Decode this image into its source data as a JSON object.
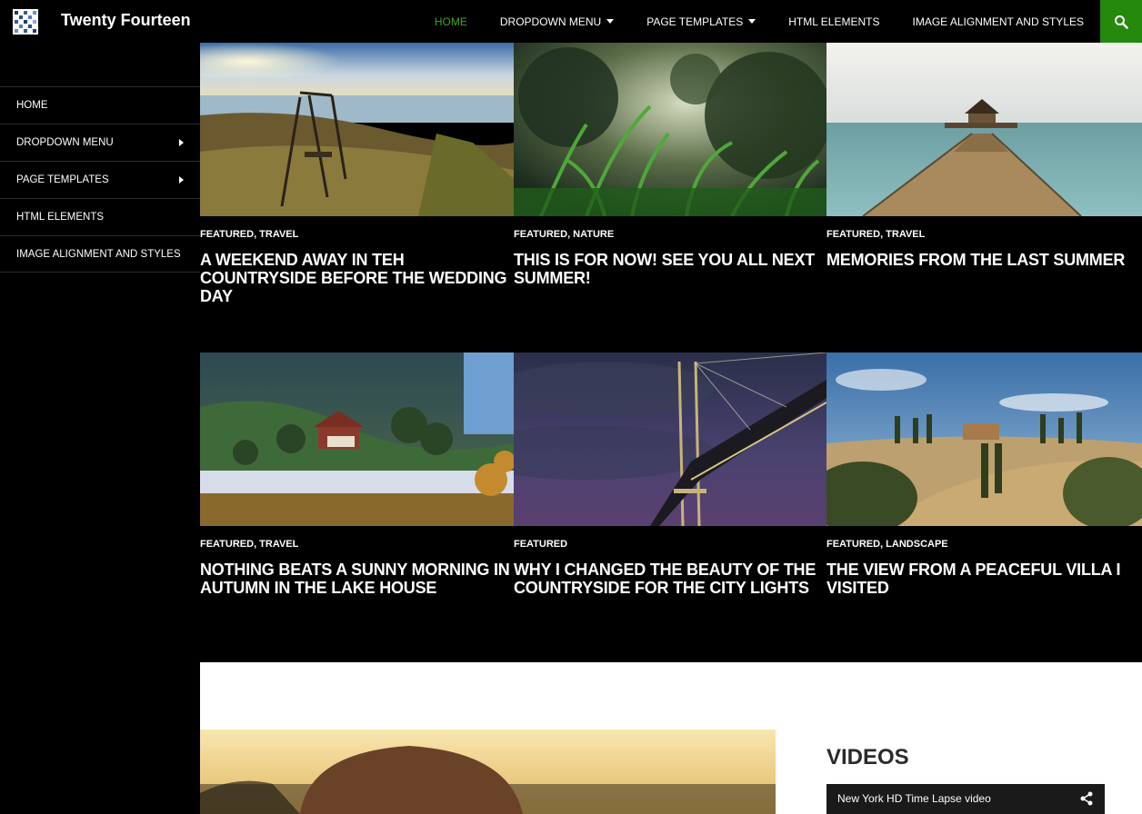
{
  "site": {
    "title": "Twenty Fourteen"
  },
  "topnav": [
    {
      "label": "HOME",
      "active": true,
      "dropdown": false
    },
    {
      "label": "DROPDOWN MENU",
      "active": false,
      "dropdown": true
    },
    {
      "label": "PAGE TEMPLATES",
      "active": false,
      "dropdown": true
    },
    {
      "label": "HTML ELEMENTS",
      "active": false,
      "dropdown": false
    },
    {
      "label": "IMAGE ALIGNMENT AND STYLES",
      "active": false,
      "dropdown": false
    }
  ],
  "sidebar": [
    {
      "label": "HOME"
    },
    {
      "label": "DROPDOWN MENU",
      "submenu": true
    },
    {
      "label": "PAGE TEMPLATES",
      "submenu": true
    },
    {
      "label": "HTML ELEMENTS"
    },
    {
      "label": "IMAGE ALIGNMENT AND STYLES"
    }
  ],
  "posts": [
    {
      "cats": "FEATURED, TRAVEL",
      "title": "A WEEKEND AWAY IN TEH COUNTRYSIDE BEFORE THE WEDDING DAY",
      "image": "swing-sunset-lake"
    },
    {
      "cats": "FEATURED, NATURE",
      "title": "THIS IS FOR NOW! SEE YOU ALL NEXT SUMMER!",
      "image": "grass-closeup"
    },
    {
      "cats": "FEATURED, TRAVEL",
      "title": "MEMORIES FROM THE LAST SUMMER",
      "image": "pier-gazebo-sea"
    },
    {
      "cats": "FEATURED, TRAVEL",
      "title": "NOTHING BEATS A SUNNY MORNING IN AUTUMN IN THE LAKE HOUSE",
      "image": "lake-house-forest"
    },
    {
      "cats": "FEATURED",
      "title": "WHY I CHANGED THE BEAUTY OF THE COUNTRYSIDE FOR THE CITY LIGHTS",
      "image": "bridge-night"
    },
    {
      "cats": "FEATURED, LANDSCAPE",
      "title": "THE VIEW FROM A PEACEFUL VILLA I VISITED",
      "image": "tuscany-villa"
    }
  ],
  "widgets": {
    "videos_heading": "VIDEOS",
    "video_title": "New York HD Time Lapse video"
  },
  "colors": {
    "accent": "#24890d",
    "active_link": "#41a62a",
    "background": "#000000"
  }
}
